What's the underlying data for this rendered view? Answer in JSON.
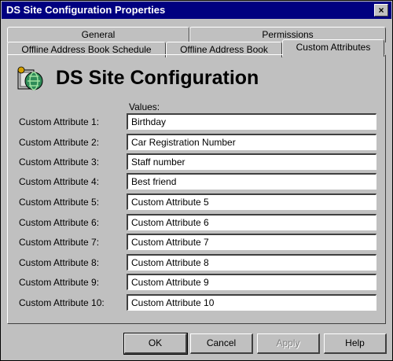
{
  "window": {
    "title": "DS Site Configuration Properties",
    "close_label": "×"
  },
  "tabs": {
    "back_row": [
      "General",
      "Permissions"
    ],
    "front_row": [
      "Offline Address Book Schedule",
      "Offline Address Book",
      "Custom Attributes"
    ],
    "active": "Custom Attributes"
  },
  "header": {
    "title": "DS Site Configuration",
    "icon": "ds-site-icon"
  },
  "form": {
    "values_label": "Values:",
    "rows": [
      {
        "label": "Custom Attribute 1:",
        "value": "Birthday"
      },
      {
        "label": "Custom Attribute 2:",
        "value": "Car Registration Number"
      },
      {
        "label": "Custom Attribute 3:",
        "value": "Staff number"
      },
      {
        "label": "Custom Attribute 4:",
        "value": "Best friend"
      },
      {
        "label": "Custom Attribute 5:",
        "value": "Custom Attribute 5"
      },
      {
        "label": "Custom Attribute 6:",
        "value": "Custom Attribute 6"
      },
      {
        "label": "Custom Attribute 7:",
        "value": "Custom Attribute 7"
      },
      {
        "label": "Custom Attribute 8:",
        "value": "Custom Attribute 8"
      },
      {
        "label": "Custom Attribute 9:",
        "value": "Custom Attribute 9"
      },
      {
        "label": "Custom Attribute 10:",
        "value": "Custom Attribute 10"
      }
    ]
  },
  "buttons": {
    "ok": "OK",
    "cancel": "Cancel",
    "apply": "Apply",
    "help": "Help"
  },
  "colors": {
    "title_bar": "#000080",
    "face": "#c0c0c0"
  }
}
